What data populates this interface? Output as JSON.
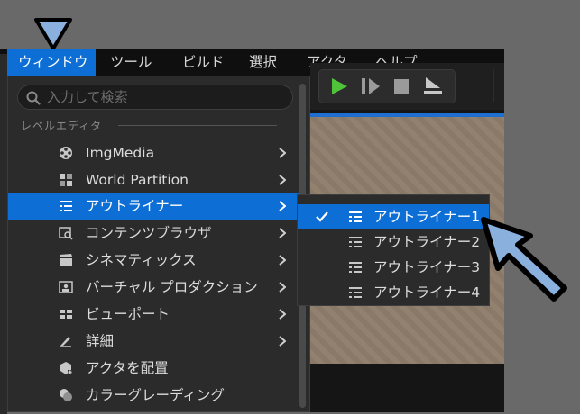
{
  "menubar": {
    "items": [
      "ウィンドウ",
      "ツール",
      "ビルド",
      "選択",
      "アクタ",
      "ヘルプ"
    ]
  },
  "dropdown": {
    "search_placeholder": "入力して検索",
    "section_label": "レベルエディタ",
    "items": [
      {
        "label": "ImgMedia",
        "icon": "film-reel-icon"
      },
      {
        "label": "World Partition",
        "icon": "grid-icon"
      },
      {
        "label": "アウトライナー",
        "icon": "outliner-icon"
      },
      {
        "label": "コンテンツブラウザ",
        "icon": "content-browser-icon"
      },
      {
        "label": "シネマティックス",
        "icon": "clapperboard-icon"
      },
      {
        "label": "バーチャル プロダクション",
        "icon": "virtual-production-icon"
      },
      {
        "label": "ビューポート",
        "icon": "viewport-icon"
      },
      {
        "label": "詳細",
        "icon": "details-icon"
      },
      {
        "label": "アクタを配置",
        "icon": "place-actors-icon"
      },
      {
        "label": "カラーグレーディング",
        "icon": "color-grading-icon"
      }
    ]
  },
  "submenu": {
    "items": [
      {
        "label": "アウトライナー1",
        "checked": true
      },
      {
        "label": "アウトライナー2",
        "checked": false
      },
      {
        "label": "アウトライナー3",
        "checked": false
      },
      {
        "label": "アウトライナー4",
        "checked": false
      }
    ]
  },
  "colors": {
    "accent": "#0d6fd6",
    "menu_bg": "#2b2b2b",
    "annotation_arrow": "#8ab0de",
    "play_green": "#4fc23a"
  }
}
